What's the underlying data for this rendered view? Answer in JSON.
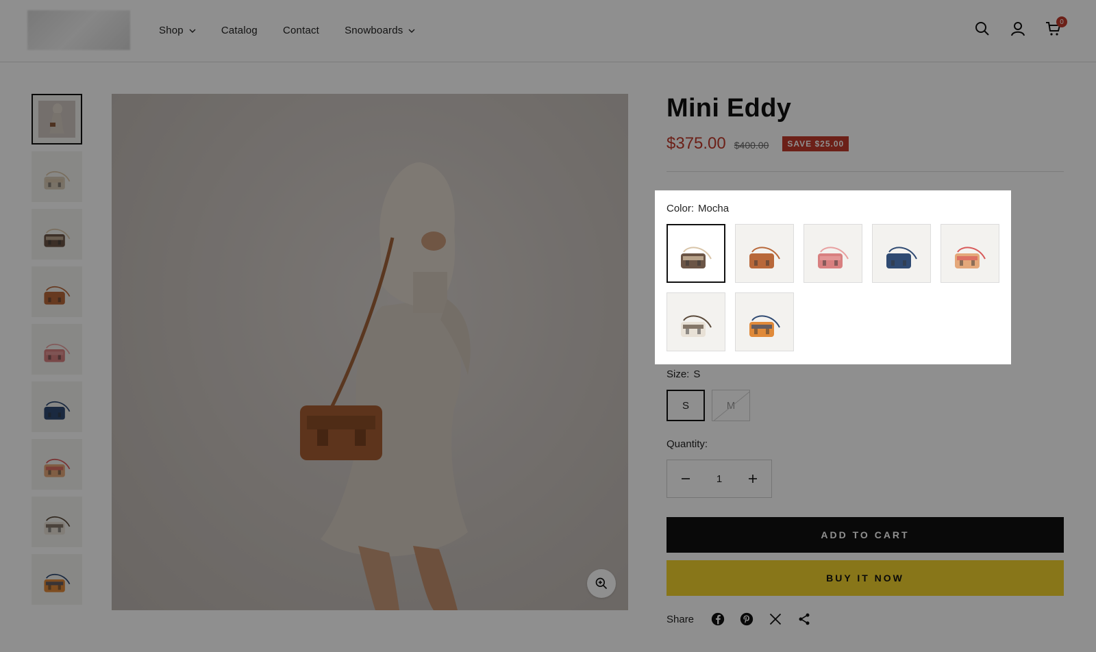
{
  "header": {
    "logo": "store-logo",
    "nav": [
      {
        "label": "Shop",
        "has_dropdown": true
      },
      {
        "label": "Catalog",
        "has_dropdown": false
      },
      {
        "label": "Contact",
        "has_dropdown": false
      },
      {
        "label": "Snowboards",
        "has_dropdown": true
      }
    ],
    "icons": [
      "search-icon",
      "account-icon",
      "cart-icon"
    ],
    "cart_count": "0"
  },
  "gallery": {
    "thumbnails": [
      {
        "name": "model-photo",
        "color": "#8a5a3b"
      },
      {
        "name": "bag-side",
        "color": "#d8cbb8"
      },
      {
        "name": "bag-mocha",
        "color": "#6b5546"
      },
      {
        "name": "bag-tan",
        "color": "#b8683a"
      },
      {
        "name": "bag-pink",
        "color": "#d88080"
      },
      {
        "name": "bag-navy",
        "color": "#2f4a72"
      },
      {
        "name": "bag-peach",
        "color": "#e4a87a"
      },
      {
        "name": "bag-cream",
        "color": "#e8e1d6"
      },
      {
        "name": "bag-orange-navy",
        "color": "#e08a3a"
      }
    ],
    "active_index": 0,
    "zoom_icon": "zoom-in-icon"
  },
  "product": {
    "title": "Mini Eddy",
    "price": "$375.00",
    "compare_price": "$400.00",
    "save_badge": "SAVE $25.00",
    "color_label": "Color:",
    "color_value": "Mocha",
    "swatches": [
      {
        "name": "mocha",
        "color": "#6b5546",
        "accent": "#d8c4a8"
      },
      {
        "name": "tan",
        "color": "#b8683a",
        "accent": "#b8683a"
      },
      {
        "name": "pink",
        "color": "#d88080",
        "accent": "#e8a0a0"
      },
      {
        "name": "navy",
        "color": "#2f4a72",
        "accent": "#2f4a72"
      },
      {
        "name": "peach",
        "color": "#e4a87a",
        "accent": "#d85a5a"
      },
      {
        "name": "cream",
        "color": "#e8e1d6",
        "accent": "#5a4a3a"
      },
      {
        "name": "orange-navy",
        "color": "#e08a3a",
        "accent": "#2f4a72"
      }
    ],
    "selected_swatch": 0,
    "size_label": "Size:",
    "size_value": "S",
    "sizes": [
      {
        "label": "S",
        "available": true
      },
      {
        "label": "M",
        "available": false
      }
    ],
    "quantity_label": "Quantity:",
    "quantity": "1",
    "add_to_cart": "ADD TO CART",
    "buy_now": "BUY IT NOW",
    "share_label": "Share",
    "share_icons": [
      "facebook-icon",
      "pinterest-icon",
      "x-icon",
      "share-icon"
    ]
  },
  "colors": {
    "price": "#c0392b",
    "badge": "#c0392b",
    "buy_now": "#f2d22e",
    "overlay": "rgba(0,0,0,0.44)"
  }
}
